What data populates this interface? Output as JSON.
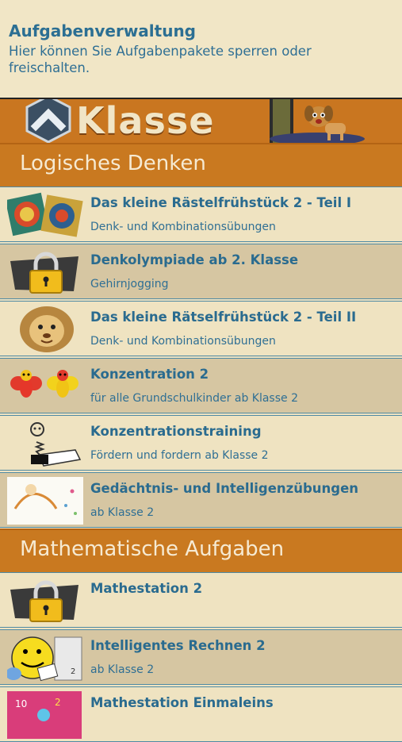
{
  "header": {
    "title": "Aufgabenverwaltung",
    "subtitle": "Hier können Sie Aufgabenpakete sperren oder freischalten."
  },
  "banner": {
    "label": "Klasse"
  },
  "sections": [
    {
      "title": "Logisches Denken",
      "items": [
        {
          "title": "Das kleine Rästelfrühstück 2 - Teil I",
          "subtitle": "Denk- und Kombinationsübungen",
          "icon": "puzzle-tiles-icon"
        },
        {
          "title": "Denkolympiade ab 2. Klasse",
          "subtitle": "Gehirnjogging",
          "icon": "padlock-icon"
        },
        {
          "title": "Das kleine Rätselfrühstück 2 - Teil II",
          "subtitle": "Denk- und Kombinationsübungen",
          "icon": "lion-icon"
        },
        {
          "title": "Konzentration 2",
          "subtitle": "für alle Grundschulkinder ab Klasse 2",
          "icon": "bees-icon"
        },
        {
          "title": "Konzentrationstraining",
          "subtitle": "Fördern und fordern ab Klasse 2",
          "icon": "spring-figure-icon"
        },
        {
          "title": "Gedächtnis- und Intelligenzübungen",
          "subtitle": "ab Klasse 2",
          "icon": "sketch-card-icon"
        }
      ]
    },
    {
      "title": "Mathematische Aufgaben",
      "items": [
        {
          "title": "Mathestation 2",
          "subtitle": "",
          "icon": "padlock-icon"
        },
        {
          "title": "Intelligentes Rechnen 2",
          "subtitle": "ab Klasse 2",
          "icon": "smiley-dice-icon"
        },
        {
          "title": "Mathestation Einmaleins",
          "subtitle": "",
          "icon": "numbers-card-icon"
        }
      ]
    }
  ]
}
